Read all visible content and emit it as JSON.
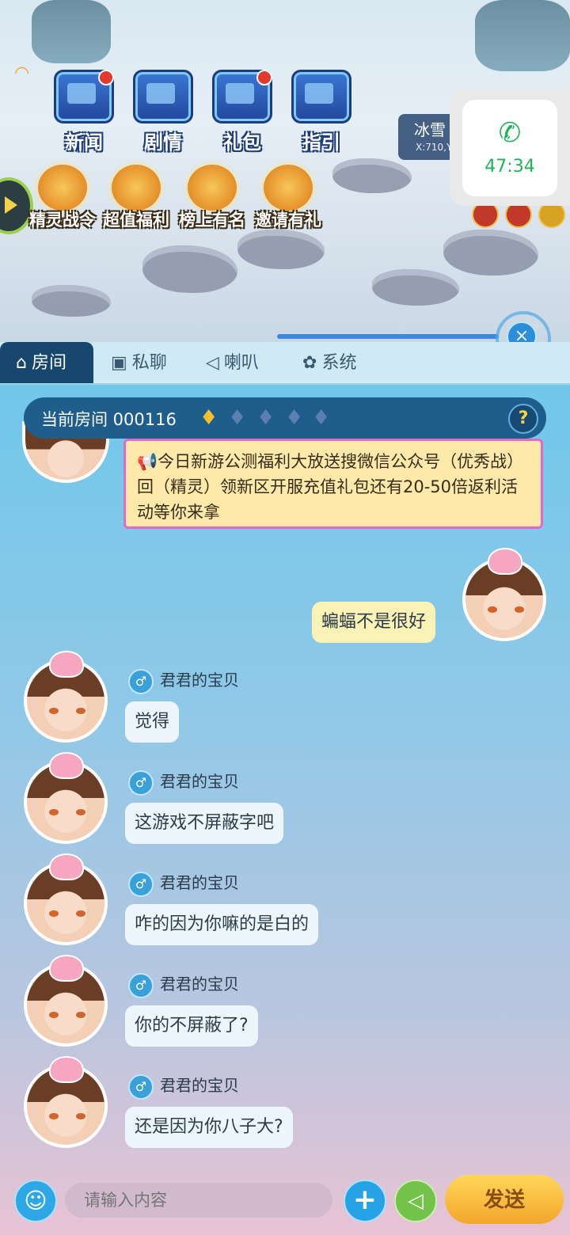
{
  "game": {
    "menu": [
      {
        "label": "新闻"
      },
      {
        "label": "剧情"
      },
      {
        "label": "礼包"
      },
      {
        "label": "指引"
      }
    ],
    "activities": [
      {
        "label": "精灵战令"
      },
      {
        "label": "超值福利"
      },
      {
        "label": "榜上有名"
      },
      {
        "label": "邀请有礼"
      }
    ],
    "location": {
      "name": "冰雪",
      "coords": "X:710,Y"
    },
    "call_timer": "47:34"
  },
  "chat": {
    "tabs": [
      {
        "label": "房间",
        "icon": "home-icon"
      },
      {
        "label": "私聊",
        "icon": "monitor-icon"
      },
      {
        "label": "喇叭",
        "icon": "megaphone-icon"
      },
      {
        "label": "系统",
        "icon": "flower-icon"
      }
    ],
    "room": {
      "label": "当前房间 000116",
      "heat_level": 1,
      "heat_max": 5
    },
    "notice": "📢今日新游公测福利大放送搜微信公众号（优秀战）回（精灵）领新区开服充值礼包还有20-50倍返利活动等你来拿",
    "messages": [
      {
        "self": true,
        "name": "",
        "text": "蝙蝠不是很好"
      },
      {
        "self": false,
        "name": "君君的宝贝",
        "text": "觉得"
      },
      {
        "self": false,
        "name": "君君的宝贝",
        "text": "这游戏不屏蔽字吧"
      },
      {
        "self": false,
        "name": "君君的宝贝",
        "text": "咋的因为你嘛的是白的"
      },
      {
        "self": false,
        "name": "君君的宝贝",
        "text": "你的不屏蔽了?"
      },
      {
        "self": false,
        "name": "君君的宝贝",
        "text": "还是因为你八子大?"
      }
    ],
    "input_placeholder": "请输入内容",
    "send_label": "发送"
  }
}
